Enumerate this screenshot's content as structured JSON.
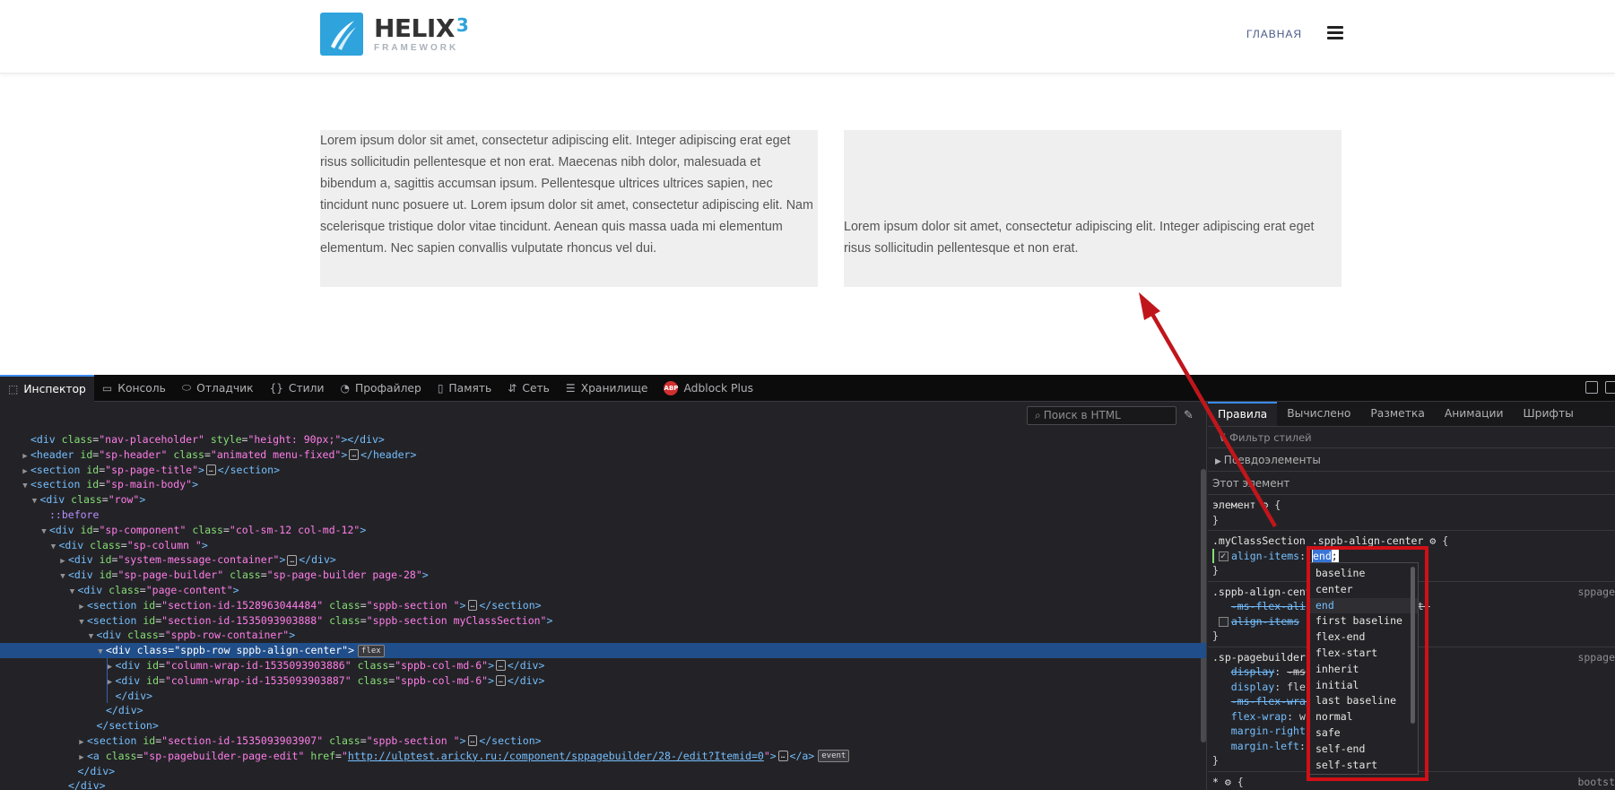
{
  "site": {
    "logo_title": "HELIX",
    "logo_num": "3",
    "logo_sub": "FRAMEWORK",
    "nav_home": "ГЛАВНАЯ",
    "col1_text": "Lorem ipsum dolor sit amet, consectetur adipiscing elit. Integer adipiscing erat eget risus sollicitudin pellentesque et non erat. Maecenas nibh dolor, malesuada et bibendum a, sagittis accumsan ipsum. Pellentesque ultrices ultrices sapien, nec tincidunt nunc posuere ut. Lorem ipsum dolor sit amet, consectetur adipiscing elit. Nam scelerisque tristique dolor vitae tincidunt. Aenean quis massa uada mi elementum elementum. Nec sapien convallis vulputate rhoncus vel dui.",
    "col2_text": "Lorem ipsum dolor sit amet, consectetur adipiscing elit. Integer adipiscing erat eget risus sollicitudin pellentesque et non erat."
  },
  "devtools": {
    "tabs": [
      {
        "label": "Инспектор",
        "icon": "inspector-icon"
      },
      {
        "label": "Консоль",
        "icon": "console-icon"
      },
      {
        "label": "Отладчик",
        "icon": "debugger-icon"
      },
      {
        "label": "Стили",
        "icon": "style-editor-icon"
      },
      {
        "label": "Профайлер",
        "icon": "profiler-icon"
      },
      {
        "label": "Память",
        "icon": "memory-icon"
      },
      {
        "label": "Сеть",
        "icon": "network-icon"
      },
      {
        "label": "Хранилище",
        "icon": "storage-icon"
      },
      {
        "label": "Adblock Plus",
        "icon": "adblock-icon"
      }
    ],
    "abp_badge": "ABP",
    "search_placeholder": "Поиск в HTML",
    "rules_tabs": [
      "Правила",
      "Вычислено",
      "Разметка",
      "Анимации",
      "Шрифты"
    ],
    "filter_placeholder": "Фильтр стилей",
    "pseudo_elements": "Псевдоэлементы",
    "this_element": "Этот элемент",
    "element_selector": "элемент",
    "rule1_selector": ".myClassSection .sppb-align-center",
    "rule1_prop": "align-items",
    "rule1_value": "end",
    "rule2_selector": ".sppb-align-cent",
    "rule2_line1_prop": "-ms-flex-ali",
    "rule2_line1_tail": "nt;",
    "rule2_line2_prop": "align-items",
    "rule2_line2_tail": "r",
    "rule2_source": "sppage",
    "rule3_selector": ".sp-pagebuilder",
    "rule3_source": "sppage",
    "rule3_lines": [
      {
        "prop": "display",
        "val": "-ms",
        "strike": true
      },
      {
        "prop": "display",
        "val": "fle",
        "strike": false
      },
      {
        "prop": "-ms-flex-wrap",
        "val": "",
        "strike": true
      },
      {
        "prop": "flex-wrap",
        "val": "w",
        "strike": false
      },
      {
        "prop": "margin-right",
        "val": "",
        "strike": false
      },
      {
        "prop": "margin-left",
        "val": "",
        "strike": false
      }
    ],
    "rule4_selector": "*",
    "rule4_source": "bootst",
    "autocomplete": [
      "baseline",
      "center",
      "end",
      "first baseline",
      "flex-end",
      "flex-start",
      "inherit",
      "initial",
      "last baseline",
      "normal",
      "safe",
      "self-end",
      "self-start"
    ],
    "autocomplete_active": "end",
    "badges": {
      "flex": "flex",
      "event": "event",
      "dots": "..."
    }
  },
  "markup": [
    {
      "indent": 0,
      "tw": "",
      "html": "<div class=\"nav-placeholder\" style=\"height: 90px;\"></div>"
    },
    {
      "indent": 0,
      "tw": "▶",
      "html": "<header id=\"sp-header\" class=\"animated menu-fixed\">…</header>"
    },
    {
      "indent": 0,
      "tw": "▶",
      "html": "<section id=\"sp-page-title\">…</section>"
    },
    {
      "indent": 0,
      "tw": "▼",
      "html": "<section id=\"sp-main-body\">"
    },
    {
      "indent": 1,
      "tw": "▼",
      "html": "<div class=\"row\">"
    },
    {
      "indent": 2,
      "tw": "",
      "html": "::before"
    },
    {
      "indent": 2,
      "tw": "▼",
      "html": "<div id=\"sp-component\" class=\"col-sm-12 col-md-12\">"
    },
    {
      "indent": 3,
      "tw": "▼",
      "html": "<div class=\"sp-column \">"
    },
    {
      "indent": 4,
      "tw": "▶",
      "html": "<div id=\"system-message-container\">…</div>"
    },
    {
      "indent": 4,
      "tw": "▼",
      "html": "<div id=\"sp-page-builder\" class=\"sp-page-builder page-28\">"
    },
    {
      "indent": 5,
      "tw": "▼",
      "html": "<div class=\"page-content\">"
    },
    {
      "indent": 6,
      "tw": "▶",
      "html": "<section id=\"section-id-1528963044484\" class=\"sppb-section \">…</section>"
    },
    {
      "indent": 6,
      "tw": "▼",
      "html": "<section id=\"section-id-1535093903888\" class=\"sppb-section myClassSection\">"
    },
    {
      "indent": 7,
      "tw": "▼",
      "html": "<div class=\"sppb-row-container\">"
    },
    {
      "indent": 8,
      "tw": "▼",
      "html": "<div class=\"sppb-row sppb-align-center\">"
    },
    {
      "indent": 9,
      "tw": "▶",
      "html": "<div id=\"column-wrap-id-1535093903886\" class=\"sppb-col-md-6\">…</div>"
    },
    {
      "indent": 9,
      "tw": "▶",
      "html": "<div id=\"column-wrap-id-1535093903887\" class=\"sppb-col-md-6\">…</div>"
    },
    {
      "indent": 9,
      "tw": "",
      "html": "</div>"
    },
    {
      "indent": 8,
      "tw": "",
      "html": "</div>"
    },
    {
      "indent": 7,
      "tw": "",
      "html": "</section>"
    },
    {
      "indent": 6,
      "tw": "▶",
      "html": "<section id=\"section-id-1535093903907\" class=\"sppb-section \">…</section>"
    },
    {
      "indent": 6,
      "tw": "▶",
      "html": "<a class=\"sp-pagebuilder-page-edit\" href=\"http://ulptest.aricky.ru:/component/sppagebuilder/28-/edit?Itemid=0\">…</a>"
    },
    {
      "indent": 5,
      "tw": "",
      "html": "</div>"
    },
    {
      "indent": 4,
      "tw": "",
      "html": "</div>"
    }
  ]
}
